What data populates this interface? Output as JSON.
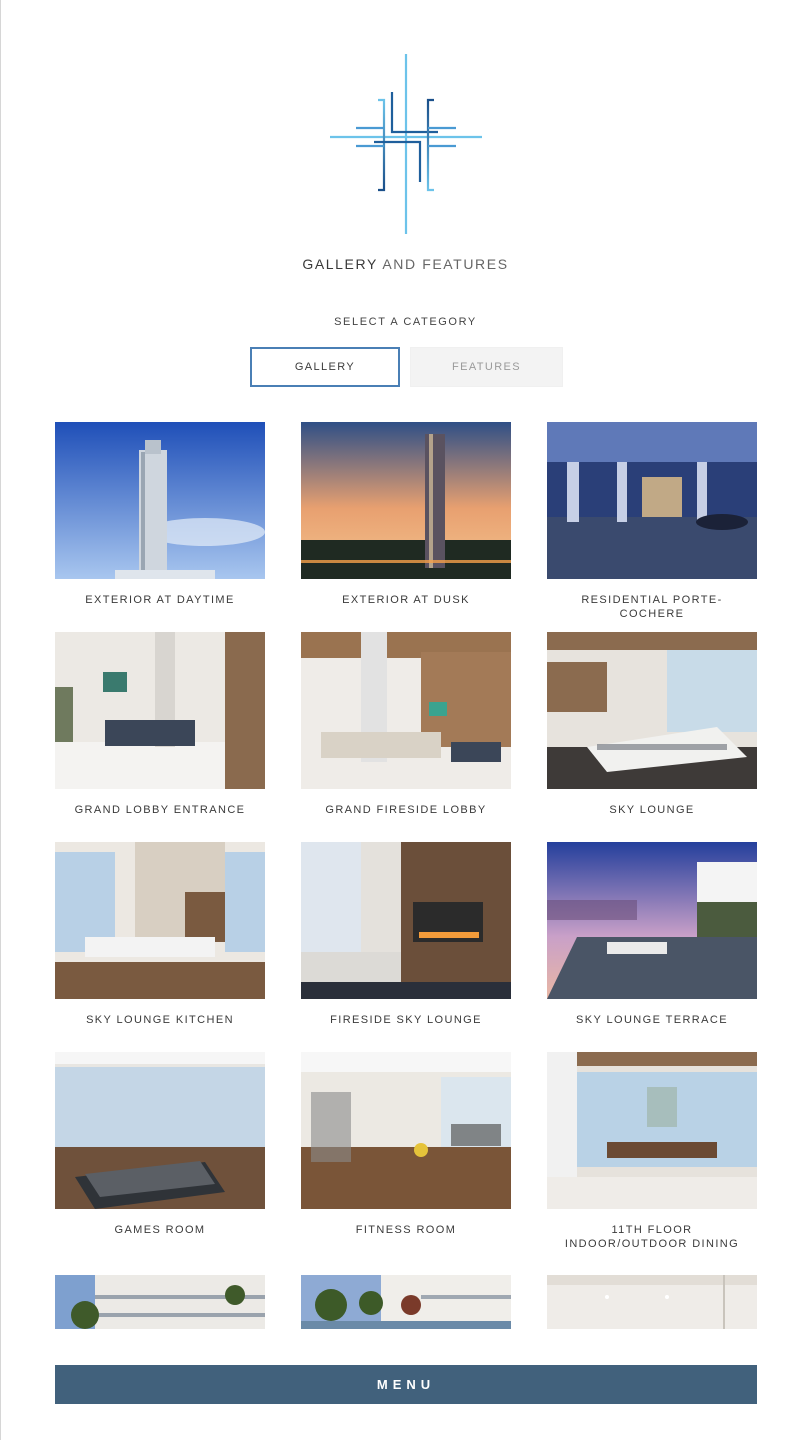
{
  "header": {
    "logo_icon": "h-monogram-icon",
    "title_strong": "GALLERY",
    "title_light": "AND FEATURES"
  },
  "category": {
    "label": "SELECT A CATEGORY",
    "tabs": [
      {
        "label": "GALLERY",
        "active": true
      },
      {
        "label": "FEATURES",
        "active": false
      }
    ]
  },
  "gallery": {
    "items": [
      {
        "caption": "EXTERIOR AT DAYTIME"
      },
      {
        "caption": "EXTERIOR AT DUSK"
      },
      {
        "caption": "RESIDENTIAL PORTE-COCHERE"
      },
      {
        "caption": "GRAND LOBBY ENTRANCE"
      },
      {
        "caption": "GRAND FIRESIDE LOBBY"
      },
      {
        "caption": "SKY LOUNGE"
      },
      {
        "caption": "SKY LOUNGE KITCHEN"
      },
      {
        "caption": "FIRESIDE SKY LOUNGE"
      },
      {
        "caption": "SKY LOUNGE TERRACE"
      },
      {
        "caption": "GAMES ROOM"
      },
      {
        "caption": "FITNESS ROOM"
      },
      {
        "caption": "11TH FLOOR INDOOR/OUTDOOR DINING"
      }
    ]
  },
  "menu": {
    "label": "MENU"
  },
  "colors": {
    "accent": "#4a7fb5",
    "menu_bar": "#41617c"
  }
}
